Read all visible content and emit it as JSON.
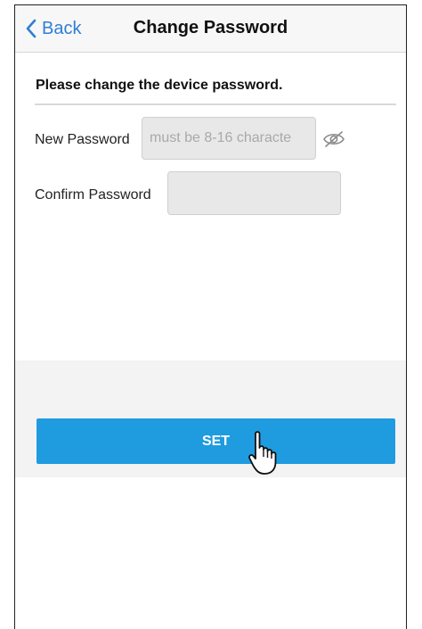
{
  "nav": {
    "back_label": "Back",
    "title": "Change Password"
  },
  "form": {
    "instruction": "Please change the device password.",
    "new_password_label": "New Password",
    "new_password_placeholder": "must be 8-16 characte",
    "new_password_value": "",
    "confirm_password_label": "Confirm Password",
    "confirm_password_value": ""
  },
  "actions": {
    "set_label": "SET"
  },
  "icons": {
    "back": "chevron-left-icon",
    "visibility": "eye-slash-icon",
    "pointer": "hand-pointer-icon"
  },
  "colors": {
    "accent": "#2f7ed6",
    "button": "#1f9be0"
  }
}
